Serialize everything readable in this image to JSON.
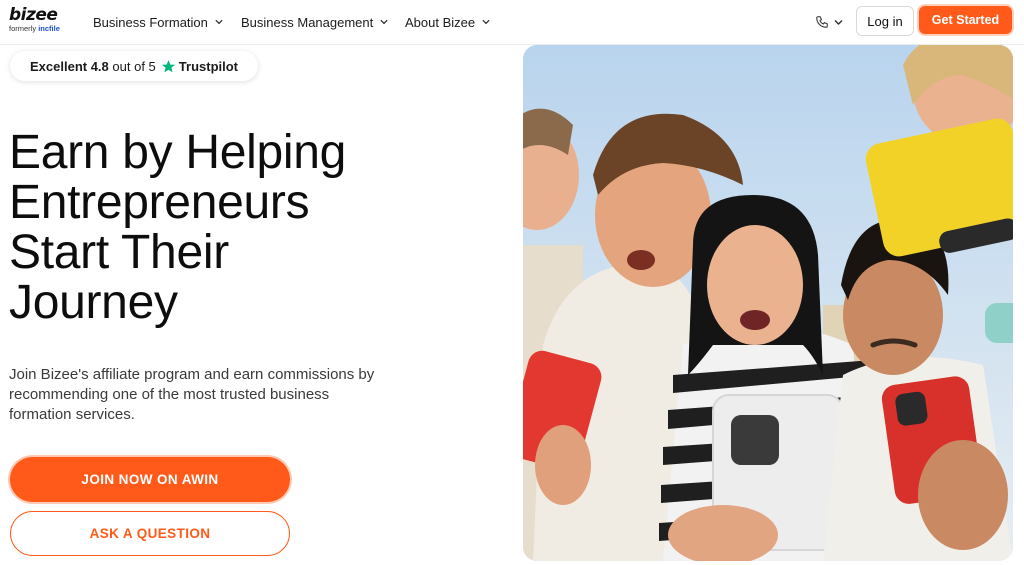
{
  "header": {
    "logo": {
      "word": "bizee",
      "sub_prefix": "formerly",
      "sub_brand": "incfile"
    },
    "nav": [
      {
        "label": "Business Formation"
      },
      {
        "label": "Business Management"
      },
      {
        "label": "About Bizee"
      }
    ],
    "login_label": "Log in",
    "get_started_label": "Get Started"
  },
  "trustpilot": {
    "rating_word": "Excellent 4.8",
    "out_of": "out of 5",
    "brand": "Trustpilot"
  },
  "hero": {
    "headline_lines": [
      "Earn by Helping",
      "Entrepreneurs",
      "Start Their",
      "Journey"
    ],
    "description": "Join Bizee's affiliate program and earn commissions by recommending one of the most trusted business formation services.",
    "primary_cta": "JOIN NOW ON AWIN",
    "secondary_cta": "ASK A QUESTION"
  },
  "colors": {
    "accent": "#ff5a1a",
    "trustpilot_green": "#00b67a",
    "logo_blue": "#1a4fd0"
  },
  "icons": {
    "nav_chevron": "chevron-down-icon",
    "phone": "phone-icon",
    "trustpilot_star": "star-icon"
  }
}
